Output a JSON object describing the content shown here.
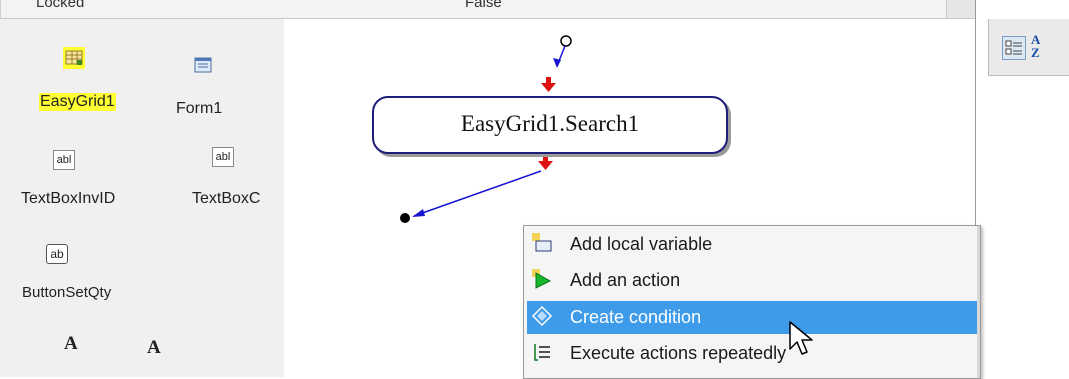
{
  "properties": {
    "name": "Locked",
    "value": "False"
  },
  "tray": {
    "components": [
      {
        "label": "EasyGrid1",
        "icon": "grid-icon",
        "selected": true
      },
      {
        "label": "Form1",
        "icon": "form-icon",
        "selected": false
      },
      {
        "label": "TextBoxInvID",
        "icon": "textbox-icon",
        "selected": false
      },
      {
        "label": "TextBoxC",
        "icon": "textbox-icon",
        "selected": false
      },
      {
        "label": "ButtonSetQty",
        "icon": "button-icon",
        "selected": false
      },
      {
        "label": "A",
        "icon": "label-icon",
        "selected": false
      },
      {
        "label": "A",
        "icon": "label-icon",
        "selected": false
      }
    ],
    "icon_text": {
      "textbox": "abl",
      "button": "ab"
    }
  },
  "canvas": {
    "action_node": {
      "label": "EasyGrid1.Search1"
    }
  },
  "right_panel": {
    "sort_icon": "sort-alphabetical-icon",
    "sort_glyph": "A Z"
  },
  "context_menu": {
    "items": [
      {
        "label": "Add local variable",
        "icon": "add-variable-icon",
        "highlighted": false
      },
      {
        "label": "Add an action",
        "icon": "add-action-icon",
        "highlighted": false
      },
      {
        "label": "Create condition",
        "icon": "condition-icon",
        "highlighted": true
      },
      {
        "label": "Execute actions repeatedly",
        "icon": "loop-icon",
        "highlighted": false
      }
    ]
  },
  "colors": {
    "highlight": "#3d9be9",
    "selection": "#ffff33",
    "arrow": "#1515d0",
    "arrow_head": "#e01010"
  }
}
